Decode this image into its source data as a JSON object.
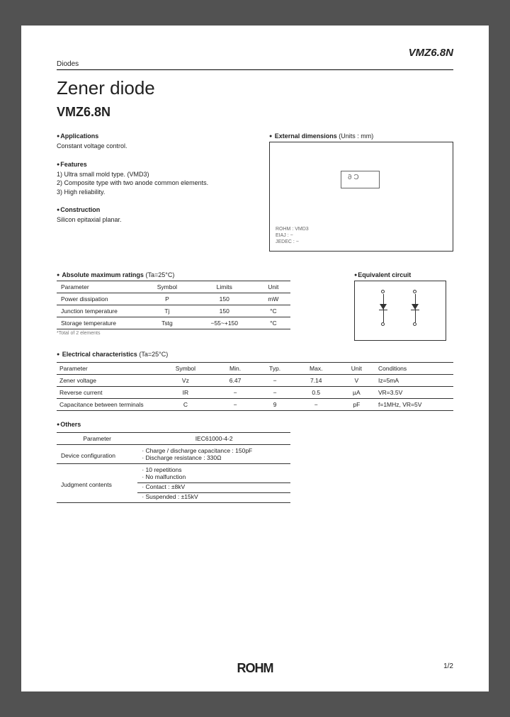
{
  "header": {
    "part_number_top": "VMZ6.8N",
    "category": "Diodes",
    "title": "Zener diode",
    "part_number_main": "VMZ6.8N"
  },
  "applications": {
    "heading": "Applications",
    "text": "Constant voltage control."
  },
  "features": {
    "heading": "Features",
    "items": [
      "1) Ultra small mold type. (VMD3)",
      "2) Composite type with two anode common elements.",
      "3) High reliability."
    ]
  },
  "construction": {
    "heading": "Construction",
    "text": "Silicon epitaxial planar."
  },
  "dimensions": {
    "heading": "External dimensions",
    "units_note": "(Units : mm)",
    "pkg_mark": "C 6",
    "labels": [
      "ROHM : VMD3",
      "EIAJ : −",
      "JEDEC : −"
    ]
  },
  "abs_ratings": {
    "heading": "Absolute maximum ratings",
    "cond": "(Ta=25°C)",
    "cols": [
      "Parameter",
      "Symbol",
      "Limits",
      "Unit"
    ],
    "rows": [
      {
        "param": "Power dissipation",
        "sym": "P",
        "lim": "150",
        "unit": "mW"
      },
      {
        "param": "Junction temperature",
        "sym": "Tj",
        "lim": "150",
        "unit": "°C"
      },
      {
        "param": "Storage temperature",
        "sym": "Tstg",
        "lim": "−55~+150",
        "unit": "°C"
      }
    ],
    "footnote": "*Total of 2 elements"
  },
  "equiv": {
    "heading": "Equivalent circuit"
  },
  "elec": {
    "heading": "Electrical characteristics",
    "cond": "(Ta=25°C)",
    "cols": [
      "Parameter",
      "Symbol",
      "Min.",
      "Typ.",
      "Max.",
      "Unit",
      "Conditions"
    ],
    "rows": [
      {
        "param": "Zener voltage",
        "sym": "Vz",
        "min": "6.47",
        "typ": "−",
        "max": "7.14",
        "unit": "V",
        "cond": "Iz=5mA"
      },
      {
        "param": "Reverse current",
        "sym": "IR",
        "min": "−",
        "typ": "−",
        "max": "0.5",
        "unit": "µA",
        "cond": "VR=3.5V"
      },
      {
        "param": "Capacitance between terminals",
        "sym": "C",
        "min": "−",
        "typ": "9",
        "max": "−",
        "unit": "pF",
        "cond": "f=1MHz, VR=5V"
      }
    ]
  },
  "others": {
    "heading": "Others",
    "cols": [
      "Parameter",
      "IEC61000-4-2"
    ],
    "rows": [
      {
        "param": "Device configuration",
        "lines": [
          "· Charge / discharge capacitance : 150pF",
          "· Discharge resistance               : 330Ω"
        ]
      },
      {
        "param": "Judgment contents",
        "lines": [
          "· 10 repetitions",
          "· No malfunction",
          "· Contact                                   : ±8kV",
          "· Suspended                              : ±15kV"
        ]
      }
    ]
  },
  "footer": {
    "logo": "ROHM",
    "page": "1/2"
  }
}
